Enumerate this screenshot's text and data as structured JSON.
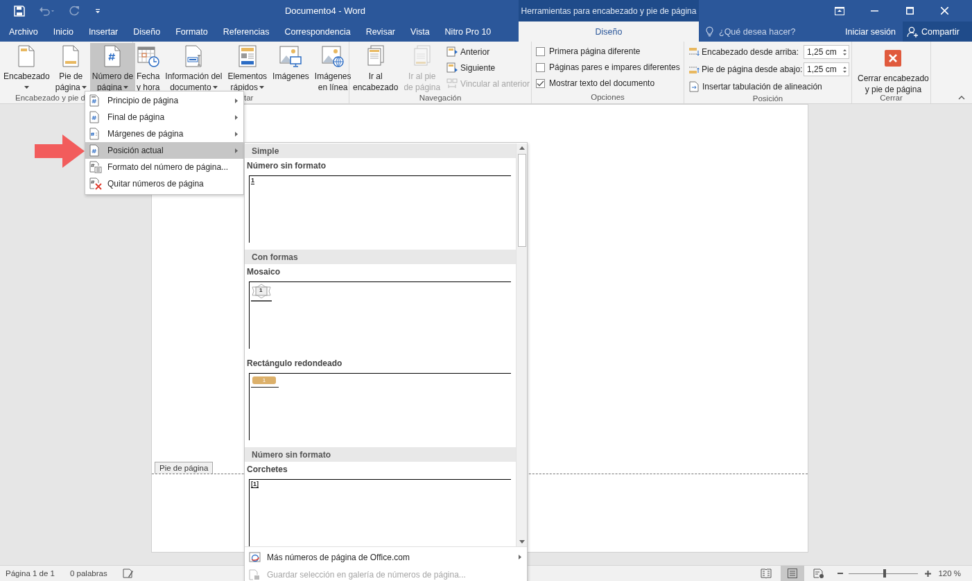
{
  "window": {
    "title": "Documento4 - Word",
    "context_header": "Herramientas para encabezado y pie de página"
  },
  "tabs": [
    {
      "label": "Archivo",
      "kind": "standard",
      "selected": false
    },
    {
      "label": "Inicio",
      "kind": "standard",
      "selected": false
    },
    {
      "label": "Insertar",
      "kind": "standard",
      "selected": false
    },
    {
      "label": "Diseño",
      "kind": "standard",
      "selected": false
    },
    {
      "label": "Formato",
      "kind": "standard",
      "selected": false
    },
    {
      "label": "Referencias",
      "kind": "standard",
      "selected": false
    },
    {
      "label": "Correspondencia",
      "kind": "standard",
      "selected": false
    },
    {
      "label": "Revisar",
      "kind": "standard",
      "selected": false
    },
    {
      "label": "Vista",
      "kind": "standard",
      "selected": false
    },
    {
      "label": "Nitro Pro 10",
      "kind": "standard",
      "selected": false
    },
    {
      "label": "Diseño",
      "kind": "contextual",
      "selected": true
    }
  ],
  "tell_me": {
    "placeholder": "¿Qué desea hacer?"
  },
  "sign_in": "Iniciar sesión",
  "share": "Compartir",
  "ribbon": {
    "header_footer": {
      "label": "Encabezado y pie d",
      "buttons": [
        {
          "lines": [
            "Encabezado"
          ],
          "dropdown": true,
          "open": false
        },
        {
          "lines": [
            "Pie de",
            "página"
          ],
          "dropdown": true,
          "open": false
        },
        {
          "lines": [
            "Número de",
            "página"
          ],
          "dropdown": true,
          "open": true
        }
      ]
    },
    "insert": {
      "label": "tar",
      "buttons": [
        {
          "lines": [
            "Fecha",
            "y hora"
          ],
          "dropdown": false,
          "open": false
        },
        {
          "lines": [
            "Información del",
            "documento"
          ],
          "dropdown": true,
          "open": false
        },
        {
          "lines": [
            "Elementos",
            "rápidos"
          ],
          "dropdown": true,
          "open": false
        },
        {
          "lines": [
            "Imágenes"
          ],
          "dropdown": false,
          "open": false
        },
        {
          "lines": [
            "Imágenes",
            "en línea"
          ],
          "dropdown": false,
          "open": false
        }
      ]
    },
    "navigation": {
      "label": "Navegación",
      "buttons": [
        {
          "lines": [
            "Ir al",
            "encabezado"
          ],
          "disabled": false
        },
        {
          "lines": [
            "Ir al pie",
            "de página"
          ],
          "disabled": true
        }
      ],
      "links": [
        {
          "label": "Anterior",
          "disabled": false
        },
        {
          "label": "Siguiente",
          "disabled": false
        },
        {
          "label": "Vincular al anterior",
          "disabled": true
        }
      ]
    },
    "options": {
      "label": "Opciones",
      "items": [
        {
          "label": "Primera página diferente",
          "checked": false
        },
        {
          "label": "Páginas pares e impares diferentes",
          "checked": false
        },
        {
          "label": "Mostrar texto del documento",
          "checked": true
        }
      ]
    },
    "position": {
      "label": "Posición",
      "spinners": [
        {
          "label": "Encabezado desde arriba:",
          "value": "1,25 cm"
        },
        {
          "label": "Pie de página desde abajo:",
          "value": "1,25 cm"
        }
      ],
      "link": "Insertar tabulación de alineación"
    },
    "close": {
      "label": "Cerrar",
      "lines": [
        "Cerrar encabezado",
        "y pie de página"
      ]
    }
  },
  "menu": {
    "items": [
      {
        "label": "Principio de página",
        "submenu": true,
        "selected": false
      },
      {
        "label": "Final de página",
        "submenu": true,
        "selected": false
      },
      {
        "label": "Márgenes de página",
        "submenu": true,
        "selected": false
      },
      {
        "label": "Posición actual",
        "submenu": true,
        "selected": true
      },
      {
        "label": "Formato del número de página...",
        "submenu": false,
        "selected": false
      },
      {
        "label": "Quitar números de página",
        "submenu": false,
        "selected": false
      }
    ]
  },
  "gallery": {
    "sections": [
      {
        "heading": "Simple",
        "entries": [
          {
            "name": "Número sin formato",
            "kind": "plain",
            "sample": "1"
          }
        ]
      },
      {
        "heading": "Con formas",
        "entries": [
          {
            "name": "Mosaico",
            "kind": "mosaic",
            "sample": "1"
          },
          {
            "name": "Rectángulo redondeado",
            "kind": "rounded",
            "sample": "1"
          }
        ]
      },
      {
        "heading": "Número sin formato",
        "entries": [
          {
            "name": "Corchetes",
            "kind": "brackets",
            "sample": "[1]"
          }
        ]
      }
    ],
    "footer": [
      {
        "label": "Más números de página de Office.com",
        "submenu": true,
        "disabled": false
      },
      {
        "label": "Guardar selección en galería de números de página...",
        "submenu": false,
        "disabled": true
      }
    ]
  },
  "document": {
    "footer_tag": "Pie de página"
  },
  "status_bar": {
    "page": "Página 1 de 1",
    "words": "0 palabras",
    "views": [
      {
        "selected": false
      },
      {
        "selected": true
      },
      {
        "selected": false
      }
    ],
    "zoom": {
      "level": 0.52,
      "reading": "120 %"
    }
  }
}
